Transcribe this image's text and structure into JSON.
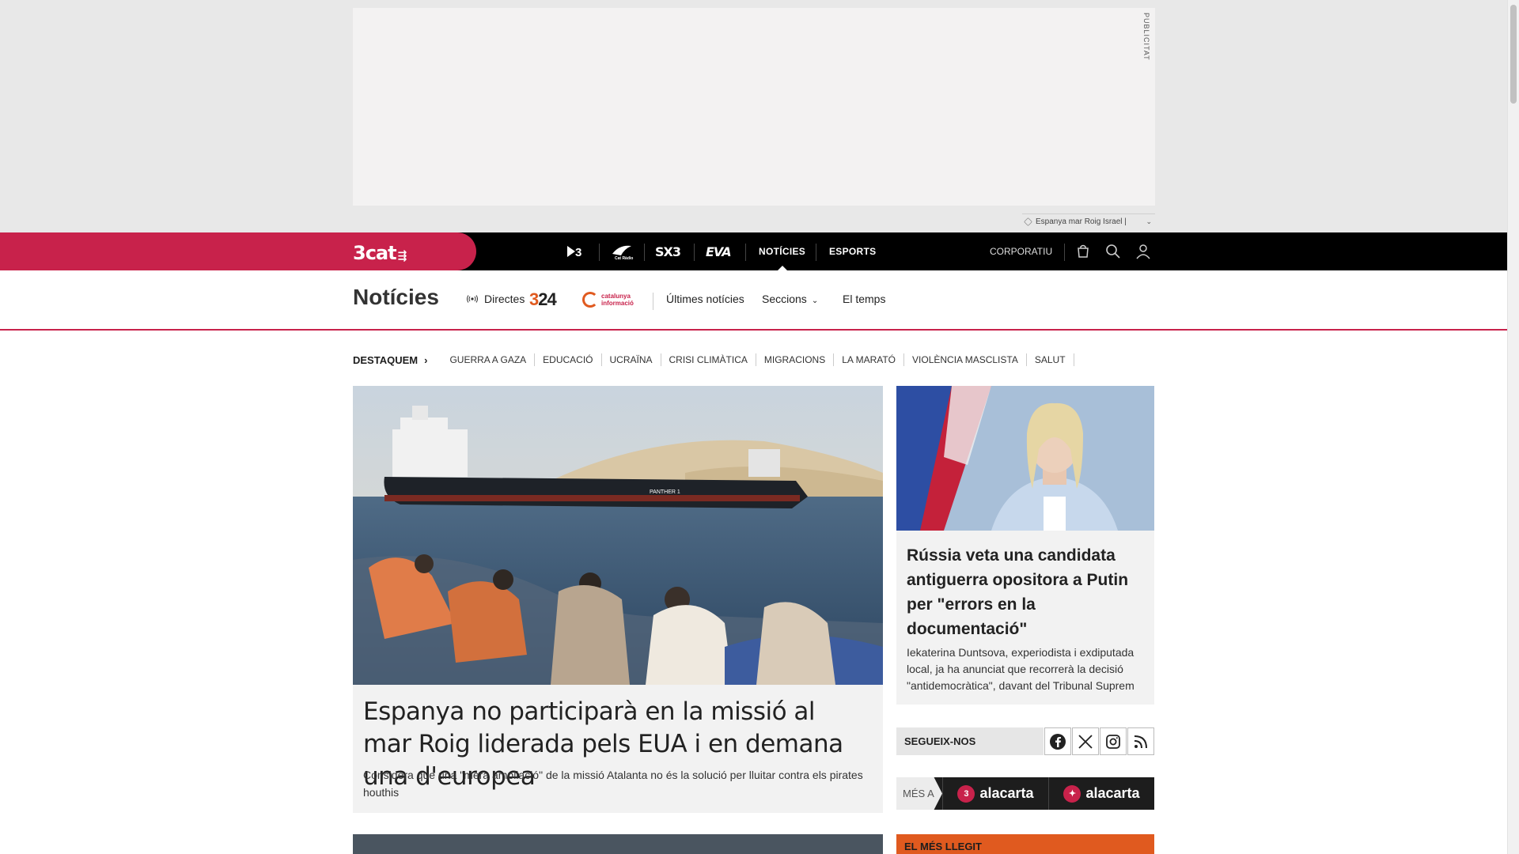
{
  "ad": {
    "label": "PUBLICITAT"
  },
  "topic_tags": {
    "text": "Espanya mar Roig Israel |"
  },
  "topnav": {
    "brand": "3cat",
    "channels": [
      "3",
      "Cat Ràdio",
      "SX3",
      "EVA"
    ],
    "links": [
      {
        "label": "NOTÍCIES",
        "active": true
      },
      {
        "label": "ESPORTS",
        "active": false
      }
    ],
    "corporate": "CORPORATIU",
    "icons": [
      "shop-icon",
      "search-icon",
      "user-icon"
    ]
  },
  "section": {
    "title": "Notícies",
    "directes": "Directes",
    "logo_324": "324",
    "logo_catinfo_line1": "catalunya",
    "logo_catinfo_line2": "informació",
    "links": [
      "Últimes notícies",
      "Seccions",
      "El temps"
    ]
  },
  "highlights": {
    "title": "DESTAQUEM",
    "items": [
      "GUERRA A GAZA",
      "EDUCACIÓ",
      "UCRAÏNA",
      "CRISI CLIMÀTICA",
      "MIGRACIONS",
      "LA MARATÓ",
      "VIOLÈNCIA MASCLISTA",
      "SALUT"
    ]
  },
  "main_story": {
    "ship_name": "PANTHER 1",
    "headline": "Espanya no participarà en la missió al mar Roig liderada pels EUA i en demana una d'europea",
    "summary": "Considera que una \"mera ampliació\" de la missió Atalanta no és la solució per lluitar contra els pirates houthis"
  },
  "side_story": {
    "headline": "Rússia veta una candidata antiguerra opositora a Putin per \"errors en la documentació\"",
    "summary": "Iekaterina Duntsova, experiodista i exdiputada local, ja ha anunciat que recorrerà la decisió \"antidemocràtica\", davant del Tribunal Suprem"
  },
  "follow": {
    "label": "SEGUEIX-NOS",
    "networks": [
      "facebook-icon",
      "x-icon",
      "instagram-icon",
      "rss-icon"
    ]
  },
  "alacarta": {
    "prefix": "MÉS A",
    "items": [
      {
        "badge": "3",
        "label": "alacarta"
      },
      {
        "badge": "✦",
        "label": "alacarta"
      }
    ]
  },
  "most_read": {
    "title": "EL MÉS LLEGIT"
  },
  "colors": {
    "brand": "#c8224b",
    "accent_orange": "#e05a1f",
    "nav_bg": "#000000"
  }
}
